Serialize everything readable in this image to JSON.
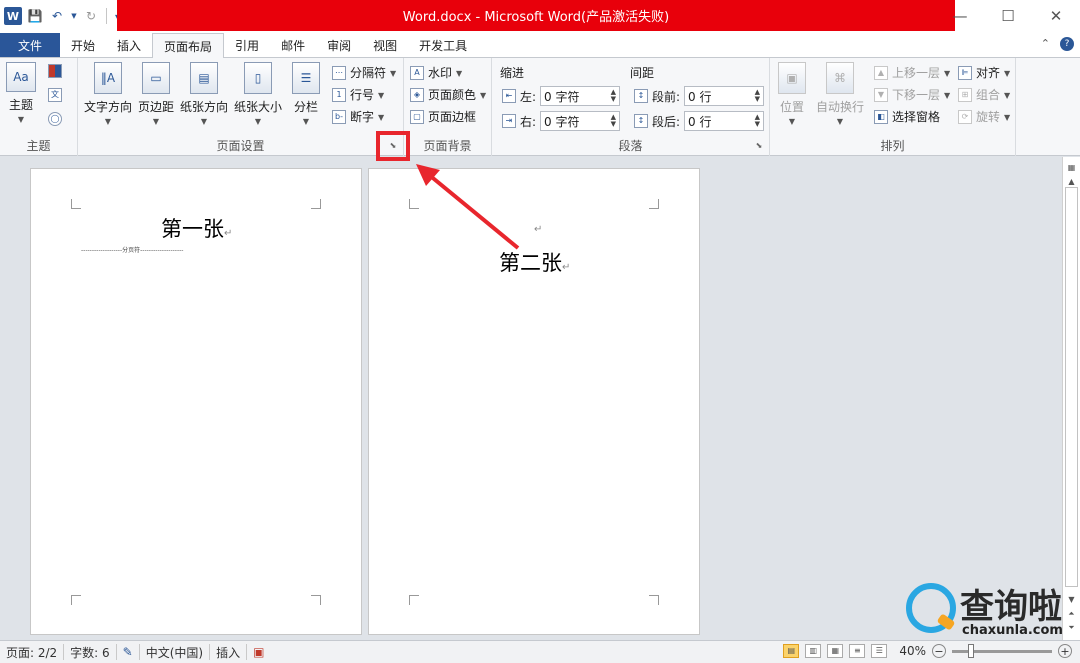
{
  "titlebar": {
    "title": "Word.docx - Microsoft Word(产品激活失败)",
    "logo": "W"
  },
  "tabs": [
    {
      "label": "文件"
    },
    {
      "label": "开始"
    },
    {
      "label": "插入"
    },
    {
      "label": "页面布局",
      "active": true
    },
    {
      "label": "引用"
    },
    {
      "label": "邮件"
    },
    {
      "label": "审阅"
    },
    {
      "label": "视图"
    },
    {
      "label": "开发工具"
    }
  ],
  "ribbon": {
    "theme": {
      "label": "主题",
      "btn": "主题",
      "font_icon": "文"
    },
    "page_setup": {
      "label": "页面设置",
      "text_direction": "文字方向",
      "margins": "页边距",
      "orientation": "纸张方向",
      "size": "纸张大小",
      "columns": "分栏",
      "breaks": "分隔符",
      "line_numbers": "行号",
      "hyphenation": "断字"
    },
    "page_background": {
      "label": "页面背景",
      "watermark": "水印",
      "page_color": "页面颜色",
      "page_borders": "页面边框"
    },
    "paragraph": {
      "label": "段落",
      "indent_title": "缩进",
      "spacing_title": "间距",
      "left_label": "左:",
      "right_label": "右:",
      "before_label": "段前:",
      "after_label": "段后:",
      "left_value": "0 字符",
      "right_value": "0 字符",
      "before_value": "0 行",
      "after_value": "0 行"
    },
    "arrange": {
      "label": "排列",
      "position": "位置",
      "wrap_text": "自动换行",
      "bring_forward": "上移一层",
      "send_backward": "下移一层",
      "selection_pane": "选择窗格",
      "align": "对齐",
      "group": "组合",
      "rotate": "旋转"
    }
  },
  "document": {
    "page1_text": "第一张",
    "page1_break": "-------------------分页符--------------------",
    "page2_text": "第二张",
    "para_mark": "↵"
  },
  "statusbar": {
    "page": "页面: 2/2",
    "words": "字数: 6",
    "language": "中文(中国)",
    "mode": "插入",
    "zoom": "40%",
    "zoom_fraction": 0.4
  },
  "watermark_logo": {
    "text": "查询啦",
    "url": "chaxunla.com"
  },
  "colors": {
    "title_red": "#e8000b",
    "file_tab": "#2a5699",
    "highlight": "#e8262d",
    "logo_blue": "#2aa7e2"
  }
}
